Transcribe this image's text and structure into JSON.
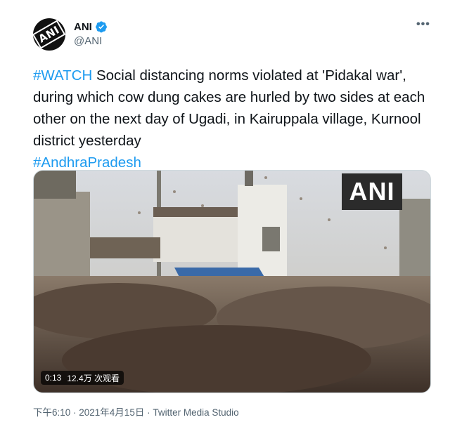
{
  "author": {
    "display_name": "ANI",
    "handle": "@ANI",
    "avatar_text": "ANI",
    "verified": true
  },
  "tweet": {
    "hashtag_watch": "#WATCH",
    "body": " Social distancing norms violated at 'Pidakal war', during which cow dung cakes are hurled by two sides at each other on the next day of Ugadi, in Kairuppala village, Kurnool district yesterday",
    "hashtag_state": "#AndhraPradesh"
  },
  "media": {
    "watermark": "ANI",
    "duration": "0:13",
    "views": "12.4万 次观看"
  },
  "meta": {
    "timestamp": "下午6:10 · 2021年4月15日",
    "source": " · Twitter Media Studio"
  },
  "colors": {
    "link": "#1d9bf0",
    "text": "#0f1419",
    "secondary": "#536471"
  },
  "icons": [
    "verified-icon",
    "more-options-icon"
  ]
}
